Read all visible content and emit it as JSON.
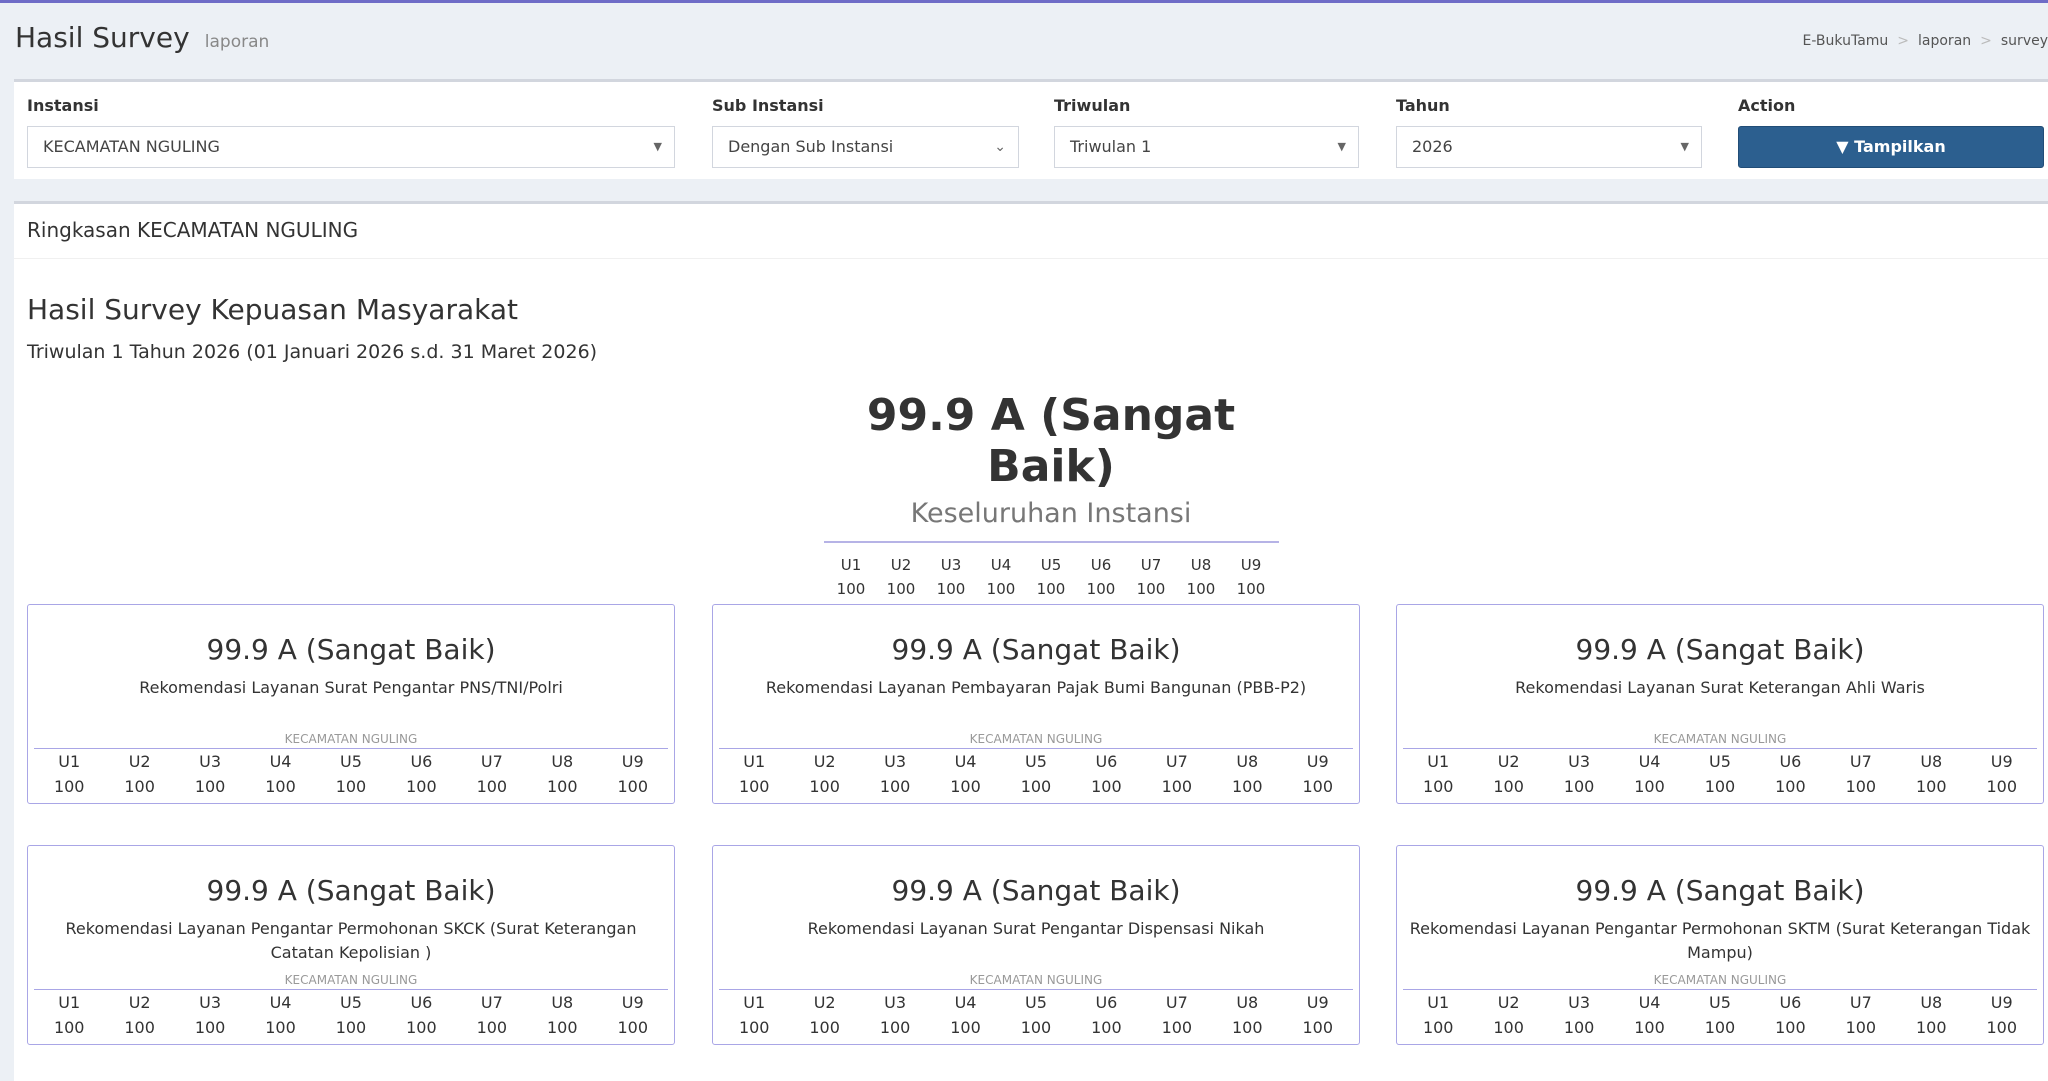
{
  "header": {
    "title": "Hasil Survey",
    "subtitle": "laporan"
  },
  "breadcrumb": [
    "E-BukuTamu",
    "laporan",
    "survey"
  ],
  "filters": {
    "instansi": {
      "label": "Instansi",
      "value": "KECAMATAN NGULING"
    },
    "sub_instansi": {
      "label": "Sub Instansi",
      "value": "Dengan Sub Instansi"
    },
    "triwulan": {
      "label": "Triwulan",
      "value": "Triwulan 1"
    },
    "tahun": {
      "label": "Tahun",
      "value": "2026"
    },
    "action": {
      "label": "Action",
      "button": "Tampilkan"
    }
  },
  "summary": {
    "header": "Ringkasan KECAMATAN NGULING",
    "title": "Hasil Survey Kepuasan Masyarakat",
    "period": "Triwulan 1 Tahun 2026 (01 Januari 2026 s.d. 31 Maret 2026)",
    "overall_score": "99.9 A (Sangat Baik)",
    "overall_label": "Keseluruhan Instansi",
    "units": [
      "U1",
      "U2",
      "U3",
      "U4",
      "U5",
      "U6",
      "U7",
      "U8",
      "U9"
    ],
    "unit_values": [
      "100",
      "100",
      "100",
      "100",
      "100",
      "100",
      "100",
      "100",
      "100"
    ]
  },
  "cards": [
    {
      "score": "99.9 A (Sangat Baik)",
      "service": "Rekomendasi Layanan Surat Pengantar PNS/TNI/Polri",
      "instansi": "KECAMATAN NGULING",
      "values": [
        "100",
        "100",
        "100",
        "100",
        "100",
        "100",
        "100",
        "100",
        "100"
      ]
    },
    {
      "score": "99.9 A (Sangat Baik)",
      "service": "Rekomendasi Layanan Pembayaran Pajak Bumi Bangunan (PBB-P2)",
      "instansi": "KECAMATAN NGULING",
      "values": [
        "100",
        "100",
        "100",
        "100",
        "100",
        "100",
        "100",
        "100",
        "100"
      ]
    },
    {
      "score": "99.9 A (Sangat Baik)",
      "service": "Rekomendasi Layanan Surat Keterangan Ahli Waris",
      "instansi": "KECAMATAN NGULING",
      "values": [
        "100",
        "100",
        "100",
        "100",
        "100",
        "100",
        "100",
        "100",
        "100"
      ]
    },
    {
      "score": "99.9 A (Sangat Baik)",
      "service": "Rekomendasi Layanan Pengantar Permohonan SKCK (Surat Keterangan Catatan Kepolisian )",
      "instansi": "KECAMATAN NGULING",
      "values": [
        "100",
        "100",
        "100",
        "100",
        "100",
        "100",
        "100",
        "100",
        "100"
      ]
    },
    {
      "score": "99.9 A (Sangat Baik)",
      "service": "Rekomendasi Layanan Surat Pengantar Dispensasi Nikah",
      "instansi": "KECAMATAN NGULING",
      "values": [
        "100",
        "100",
        "100",
        "100",
        "100",
        "100",
        "100",
        "100",
        "100"
      ]
    },
    {
      "score": "99.9 A (Sangat Baik)",
      "service": "Rekomendasi Layanan Pengantar Permohonan SKTM (Surat Keterangan Tidak Mampu)",
      "instansi": "KECAMATAN NGULING",
      "values": [
        "100",
        "100",
        "100",
        "100",
        "100",
        "100",
        "100",
        "100",
        "100"
      ]
    }
  ]
}
